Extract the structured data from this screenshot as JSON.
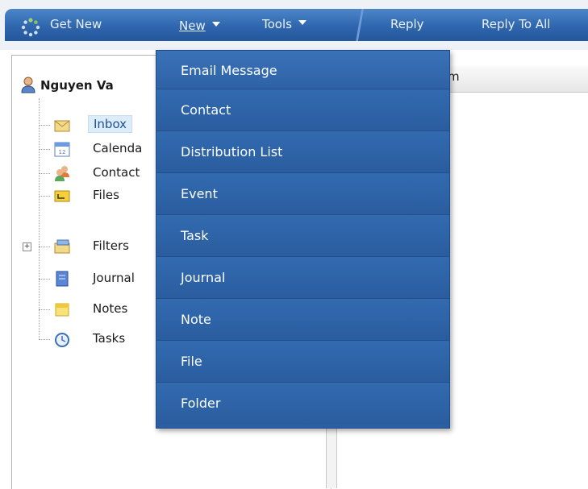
{
  "toolbar": {
    "get_new": "Get New",
    "new": "New",
    "tools": "Tools",
    "reply": "Reply",
    "reply_all": "Reply To All"
  },
  "user": {
    "name": "Nguyen Va"
  },
  "right_pane": {
    "header_text": "m"
  },
  "tree": [
    {
      "label": "Inbox",
      "icon": "inbox-icon",
      "selected": true
    },
    {
      "label": "Calenda",
      "icon": "calendar-icon"
    },
    {
      "label": "Contact",
      "icon": "contacts-icon"
    },
    {
      "label": "Files",
      "icon": "files-icon"
    },
    {
      "label": "Filters",
      "icon": "filters-icon",
      "expandable": true
    },
    {
      "label": "Journal",
      "icon": "journal-icon"
    },
    {
      "label": "Notes",
      "icon": "notes-icon"
    },
    {
      "label": "Tasks",
      "icon": "tasks-icon"
    }
  ],
  "menu": {
    "items": [
      {
        "label": "Email Message"
      },
      {
        "label": "Contact"
      },
      {
        "label": "Distribution List"
      },
      {
        "label": "Event"
      },
      {
        "label": "Task"
      },
      {
        "label": "Journal"
      },
      {
        "label": "Note"
      },
      {
        "label": "File"
      },
      {
        "label": "Folder"
      }
    ]
  },
  "colors": {
    "toolbar": "#2f66ae",
    "menu": "#2b5ea3",
    "selection": "#dcecf9"
  }
}
